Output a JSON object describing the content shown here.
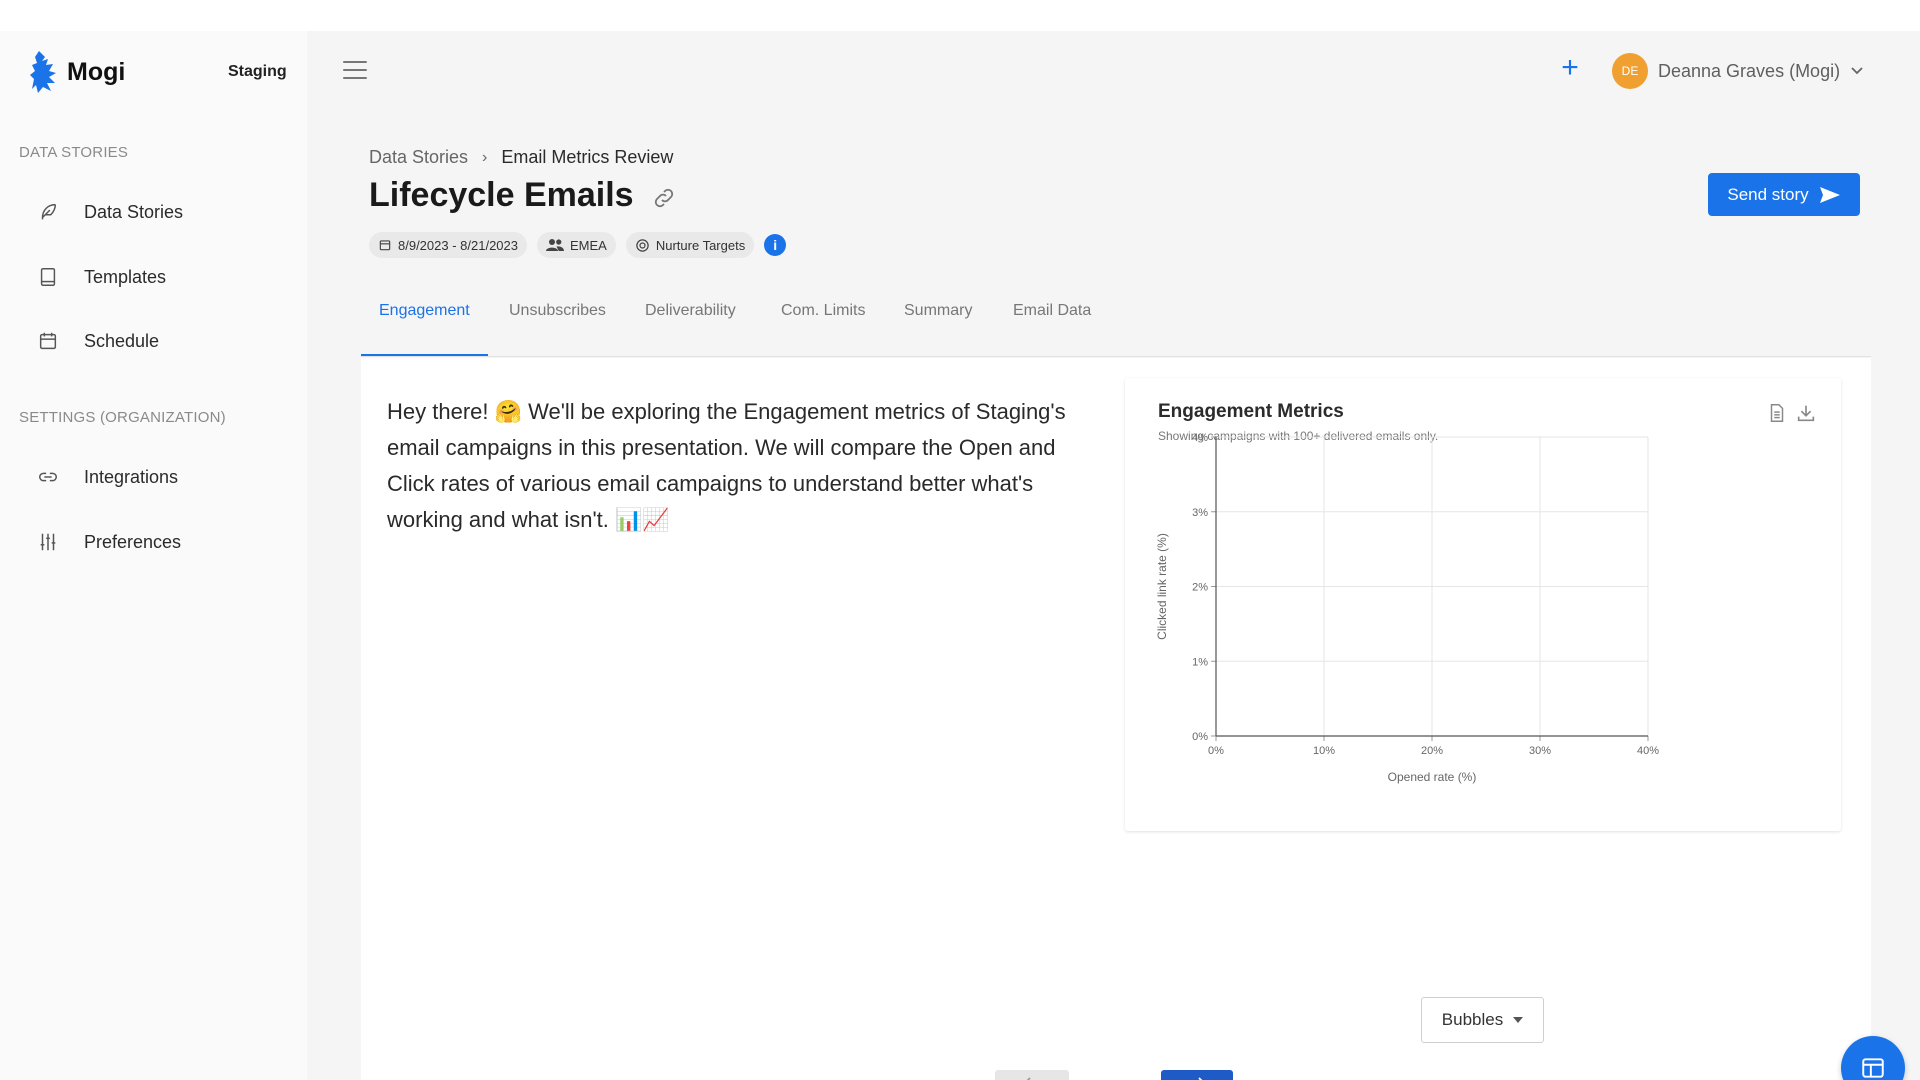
{
  "brand": {
    "name": "Mogi",
    "environment": "Staging"
  },
  "sidebar": {
    "sections": [
      {
        "label": "DATA STORIES",
        "items": [
          {
            "label": "Data Stories",
            "icon": "feather-icon"
          },
          {
            "label": "Templates",
            "icon": "book-icon"
          },
          {
            "label": "Schedule",
            "icon": "calendar-icon"
          }
        ]
      },
      {
        "label": "SETTINGS (ORGANIZATION)",
        "items": [
          {
            "label": "Integrations",
            "icon": "link-icon"
          },
          {
            "label": "Preferences",
            "icon": "sliders-icon"
          }
        ]
      }
    ]
  },
  "header": {
    "user": {
      "initials": "DE",
      "name": "Deanna Graves (Mogi)"
    }
  },
  "breadcrumb": {
    "parent": "Data Stories",
    "current": "Email Metrics Review"
  },
  "page": {
    "title": "Lifecycle Emails",
    "send_label": "Send story"
  },
  "chips": {
    "date_range": "8/9/2023 - 8/21/2023",
    "region": "EMEA",
    "segment": "Nurture Targets",
    "info": "i"
  },
  "tabs": [
    {
      "label": "Engagement",
      "active": true
    },
    {
      "label": "Unsubscribes"
    },
    {
      "label": "Deliverability"
    },
    {
      "label": "Com. Limits"
    },
    {
      "label": "Summary"
    },
    {
      "label": "Email Data"
    }
  ],
  "content": {
    "intro": "Hey there! 🤗 We'll be exploring the Engagement metrics of Staging's email campaigns in this presentation. We will compare the Open and Click rates of various email campaigns to understand better what's working and what isn't. 📊📈"
  },
  "chart_panel": {
    "title": "Engagement Metrics",
    "subtitle": "Showing campaigns with 100+ delivered emails only."
  },
  "chart_data": {
    "type": "scatter",
    "title": "Engagement Metrics",
    "xlabel": "Opened rate (%)",
    "ylabel": "Clicked link rate (%)",
    "xlim": [
      0,
      40
    ],
    "ylim": [
      0,
      4
    ],
    "x_ticks": [
      "0%",
      "10%",
      "20%",
      "30%",
      "40%"
    ],
    "y_ticks": [
      "0%",
      "1%",
      "2%",
      "3%",
      "4%"
    ],
    "grid": true,
    "points": []
  },
  "view_select": {
    "value": "Bubbles"
  },
  "colors": {
    "accent": "#1a73e8",
    "next_button": "#1e5bc6",
    "avatar": "#f0a030"
  }
}
